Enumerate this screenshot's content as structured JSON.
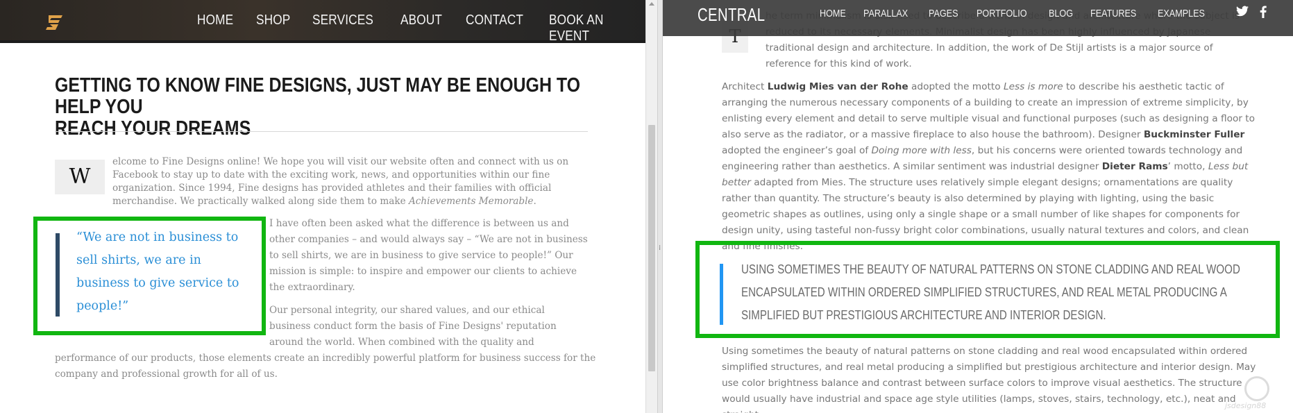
{
  "left": {
    "nav": {
      "logo_icon": "stylized-s-logo",
      "items": [
        "HOME",
        "SHOP",
        "SERVICES",
        "ABOUT",
        "CONTACT",
        "BOOK AN EVENT"
      ]
    },
    "heading_line1": "GETTING TO KNOW FINE DESIGNS, JUST MAY BE ENOUGH TO HELP YOU",
    "heading_line2": "REACH YOUR DREAMS",
    "dropcap": "W",
    "intro_text": "elcome to Fine Designs online! We hope you will visit our website often and connect with us on Facebook to stay up to date with the exciting work, news, and opportunities within our fine organization. Since 1994, Fine designs has provided athletes and their families with official merchandise. We practically walked along side them to make ",
    "intro_emphasis": "Achievements Memorable",
    "intro_end": ".",
    "quote": "“We are not in business to sell shirts, we are in business to give service to people!”",
    "para2": "I have often been asked what the difference is between us and other companies – and would always say – “We are not in business to sell shirts, we are in business to give service to people!” Our mission is simple: to inspire and empower our clients to achieve the extraordinary.",
    "para3a": "Our personal integrity, our shared values, and our ethical business conduct form the basis of Fine Designs' reputation around the world. When combined with the quality and",
    "para3b": "performance of our products, those elements create an incredibly powerful platform for business success for the company and professional growth for all of us."
  },
  "right": {
    "nav": {
      "brand": "CENTRAL",
      "items": [
        "HOME",
        "PARALLAX",
        "PAGES",
        "PORTFOLIO",
        "BLOG",
        "FEATURES",
        "EXAMPLES"
      ],
      "social_icons": [
        "twitter-icon",
        "facebook-icon"
      ]
    },
    "dropcap": "T",
    "p1_visible": "he term minimalism is also used to describe a trend in design and architecture where the subject is reduced to its necessary elements. Minimalist design has been highly influenced by Japanese traditional design and architecture. In addition, the work of De Stijl artists is a major source of reference for this kind of work.",
    "p2": {
      "a": "Architect ",
      "b1": "Ludwig Mies van der Rohe",
      "c": " adopted the motto ",
      "e1": "Less is more",
      "d": " to describe his aesthetic tactic of arranging the numerous necessary components of a building to create an impression of extreme simplicity, by enlisting every element and detail to serve multiple visual and functional purposes (such as designing a floor to also serve as the radiator, or a massive fireplace to also house the bathroom). Designer ",
      "b2": "Buckminster Fuller",
      "f": " adopted the engineer’s goal of ",
      "e2": "Doing more with less",
      "g": ", but his concerns were oriented towards technology and engineering rather than aesthetics. A similar sentiment was industrial designer ",
      "b3": "Dieter Rams",
      "h": "’ motto, ",
      "e3": "Less but better",
      "i": " adapted from Mies. The structure uses relatively simple elegant designs; ornamentations are quality rather than quantity. The structure’s beauty is also determined by playing with lighting, using the basic geometric shapes as outlines, using only a single shape or a small number of like shapes for components for design unity, using tasteful non-fussy bright color combinations, usually natural textures and colors, and clean and fine finishes."
    },
    "quote": "USING SOMETIMES THE BEAUTY OF NATURAL PATTERNS ON STONE CLADDING AND REAL WOOD ENCAPSULATED WITHIN ORDERED SIMPLIFIED STRUCTURES, AND REAL METAL PRODUCING A SIMPLIFIED BUT PRESTIGIOUS ARCHITECTURE AND INTERIOR DESIGN.",
    "p3": "Using sometimes the beauty of natural patterns on stone cladding and real wood encapsulated within ordered simplified structures, and real metal producing a simplified but prestigious architecture and interior design. May use color brightness balance and contrast between surface colors to improve visual aesthetics. The structure would usually have industrial and space age style utilities (lamps, stoves, stairs, technology, etc.), neat and straight"
  },
  "watermark": "jsdesign88",
  "colors": {
    "highlight_box": "#11b611",
    "left_quote_text": "#2b8fd6",
    "left_quote_bar": "#2e4a66",
    "right_quote_bar": "#2196f3"
  }
}
